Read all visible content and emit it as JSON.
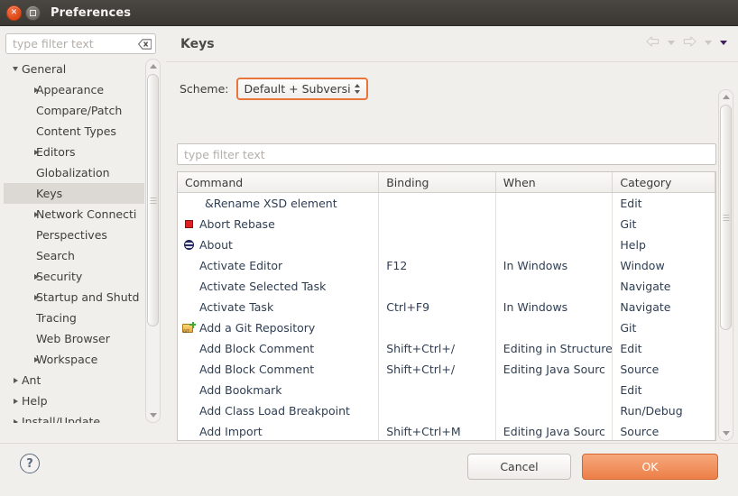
{
  "window": {
    "title": "Preferences",
    "close_icon": "close-icon",
    "maximize_icon": "maximize-icon"
  },
  "sidebar": {
    "filter_placeholder": "type filter text",
    "filter_value": "",
    "clear_icon": "clear-icon",
    "items": [
      {
        "label": "General",
        "indent": 0,
        "arrow": "down",
        "selected": false
      },
      {
        "label": "Appearance",
        "indent": 1,
        "arrow": "right",
        "selected": false
      },
      {
        "label": "Compare/Patch",
        "indent": 1,
        "arrow": "none",
        "selected": false
      },
      {
        "label": "Content Types",
        "indent": 1,
        "arrow": "none",
        "selected": false
      },
      {
        "label": "Editors",
        "indent": 1,
        "arrow": "right",
        "selected": false
      },
      {
        "label": "Globalization",
        "indent": 1,
        "arrow": "none",
        "selected": false
      },
      {
        "label": "Keys",
        "indent": 1,
        "arrow": "none",
        "selected": true
      },
      {
        "label": "Network Connecti",
        "indent": 1,
        "arrow": "right",
        "selected": false
      },
      {
        "label": "Perspectives",
        "indent": 1,
        "arrow": "none",
        "selected": false
      },
      {
        "label": "Search",
        "indent": 1,
        "arrow": "none",
        "selected": false
      },
      {
        "label": "Security",
        "indent": 1,
        "arrow": "right",
        "selected": false
      },
      {
        "label": "Startup and Shutd",
        "indent": 1,
        "arrow": "right",
        "selected": false
      },
      {
        "label": "Tracing",
        "indent": 1,
        "arrow": "none",
        "selected": false
      },
      {
        "label": "Web Browser",
        "indent": 1,
        "arrow": "none",
        "selected": false
      },
      {
        "label": "Workspace",
        "indent": 1,
        "arrow": "right",
        "selected": false
      },
      {
        "label": "Ant",
        "indent": 0,
        "arrow": "right",
        "selected": false
      },
      {
        "label": "Help",
        "indent": 0,
        "arrow": "right",
        "selected": false
      },
      {
        "label": "Install/Update",
        "indent": 0,
        "arrow": "right",
        "selected": false
      }
    ]
  },
  "main": {
    "page_title": "Keys",
    "nav": {
      "back_icon": "back-arrow-icon",
      "back_dropdown_icon": "chevron-down-icon",
      "forward_icon": "forward-arrow-icon",
      "forward_dropdown_icon": "chevron-down-icon",
      "menu_icon": "view-menu-icon"
    },
    "scheme": {
      "label": "Scheme:",
      "value": "Default + Subversi",
      "spinner_icon": "spinner-updown-icon"
    },
    "filter_placeholder": "type filter text",
    "filter_value": "",
    "table": {
      "columns": [
        "Command",
        "Binding",
        "When",
        "Category"
      ],
      "rows": [
        {
          "icon": "none",
          "command": "&Rename XSD element",
          "binding": "",
          "when": "",
          "category": "Edit",
          "indent": true
        },
        {
          "icon": "stop",
          "command": "Abort Rebase",
          "binding": "",
          "when": "",
          "category": "Git",
          "indent": false
        },
        {
          "icon": "about",
          "command": "About",
          "binding": "",
          "when": "",
          "category": "Help",
          "indent": false
        },
        {
          "icon": "none",
          "command": "Activate Editor",
          "binding": "F12",
          "when": "In Windows",
          "category": "Window",
          "indent": false
        },
        {
          "icon": "none",
          "command": "Activate Selected Task",
          "binding": "",
          "when": "",
          "category": "Navigate",
          "indent": false
        },
        {
          "icon": "none",
          "command": "Activate Task",
          "binding": "Ctrl+F9",
          "when": "In Windows",
          "category": "Navigate",
          "indent": false
        },
        {
          "icon": "gitrepo",
          "command": "Add a Git Repository",
          "binding": "",
          "when": "",
          "category": "Git",
          "indent": false
        },
        {
          "icon": "none",
          "command": "Add Block Comment",
          "binding": "Shift+Ctrl+/",
          "when": "Editing in Structure",
          "category": "Edit",
          "indent": false
        },
        {
          "icon": "none",
          "command": "Add Block Comment",
          "binding": "Shift+Ctrl+/",
          "when": "Editing Java Sourc",
          "category": "Source",
          "indent": false
        },
        {
          "icon": "none",
          "command": "Add Bookmark",
          "binding": "",
          "when": "",
          "category": "Edit",
          "indent": false
        },
        {
          "icon": "none",
          "command": "Add Class Load Breakpoint",
          "binding": "",
          "when": "",
          "category": "Run/Debug",
          "indent": false
        },
        {
          "icon": "none",
          "command": "Add Import",
          "binding": "Shift+Ctrl+M",
          "when": "Editing Java Sourc",
          "category": "Source",
          "indent": false
        }
      ]
    }
  },
  "footer": {
    "help_label": "?",
    "cancel_label": "Cancel",
    "ok_label": "OK"
  },
  "colors": {
    "accent": "#dd4814",
    "ok_button": "#ec7f48",
    "focus_border": "#e8763b",
    "titlebar": "#3b3733",
    "selection": "#dcd9d4"
  }
}
